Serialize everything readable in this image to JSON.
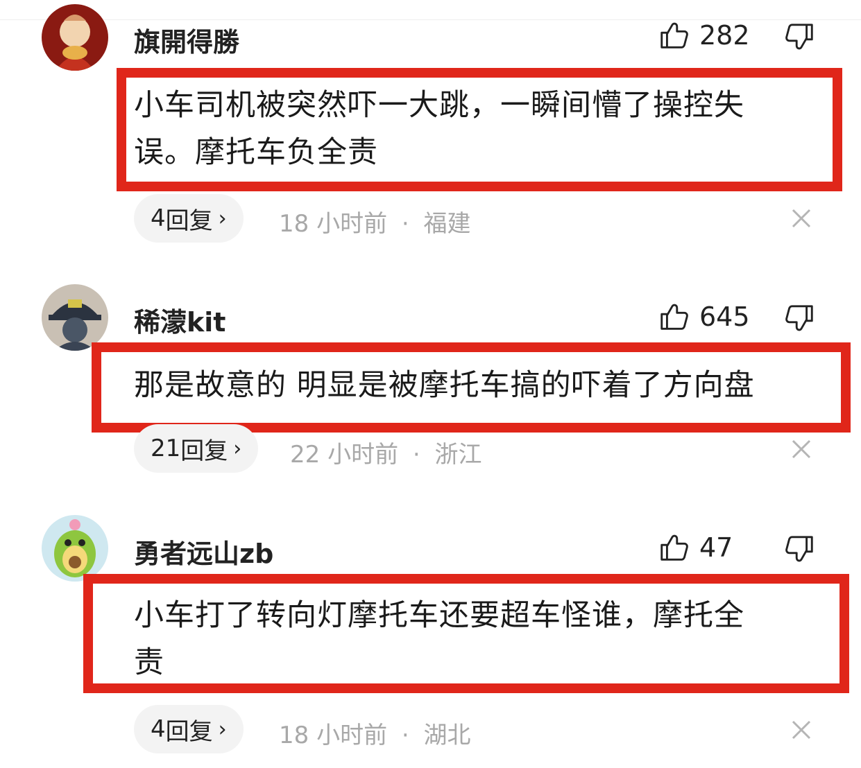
{
  "comments": [
    {
      "username": "旗開得勝",
      "likes": "282",
      "text_lines": [
        "小车司机被突然吓一大跳，一瞬间懵了操控失",
        "误。摩托车负全责"
      ],
      "replies": "4",
      "reply_label": "回复",
      "time": "18 小时前",
      "sep": "·",
      "location": "福建",
      "avatar_colors": [
        "#8a1a12",
        "#d99a6c",
        "#f2d4b0"
      ]
    },
    {
      "username": "稀濛kit",
      "likes": "645",
      "text_lines": [
        "那是故意的 明显是被摩托车搞的吓着了方向盘"
      ],
      "replies": "21",
      "reply_label": "回复",
      "time": "22 小时前",
      "sep": "·",
      "location": "浙江",
      "avatar_colors": [
        "#2b3340",
        "#c9c0b4",
        "#4a5666"
      ]
    },
    {
      "username": "勇者远山zb",
      "likes": "47",
      "text_lines": [
        "小车打了转向灯摩托车还要超车怪谁，摩托全",
        "责"
      ],
      "replies": "4",
      "reply_label": "回复",
      "time": "18 小时前",
      "sep": "·",
      "location": "湖北",
      "avatar_colors": [
        "#cfe8f0",
        "#8ec63f",
        "#f4d97a"
      ]
    }
  ],
  "icons": {
    "like": "thumbs-up-icon",
    "dislike": "thumbs-down-icon",
    "close": "close-icon",
    "chevron": "chevron-right-icon"
  },
  "highlight_color": "#e0261a"
}
